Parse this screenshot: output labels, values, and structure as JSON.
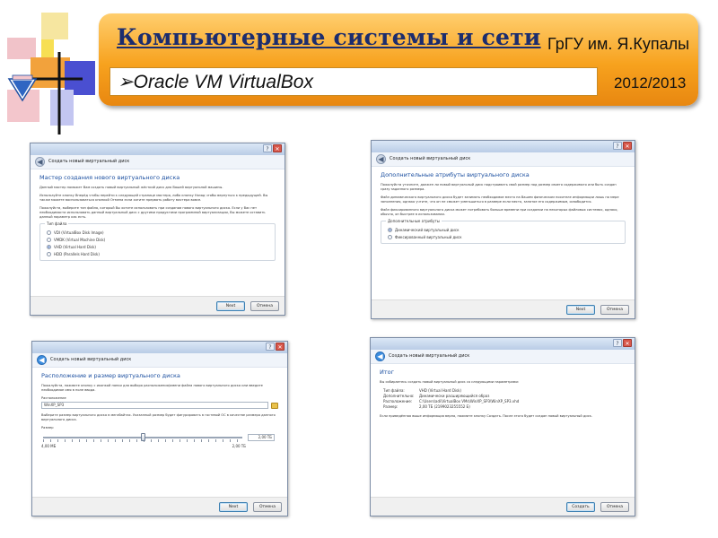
{
  "banner": {
    "title": "Компьютерные системы и сети",
    "university": "ГрГУ им. Я.Купалы",
    "subtitle": "Oracle VM VirtualBox",
    "year": "2012/2013"
  },
  "colors": {
    "banner_gradient": [
      "#ffce6e",
      "#f7a21e",
      "#e88710"
    ],
    "title_color": "#1c2d6e",
    "heading_color": "#1b4fa0"
  },
  "dialogs": {
    "wizard": {
      "caption": "Создать новый виртуальный диск",
      "heading": "Мастер создания нового виртуального диска",
      "p1": "Данный мастер поможет Вам создать новый виртуальный жёсткий диск для Вашей виртуальной машины.",
      "p2": "Используйте кнопку Вперёд чтобы перейти к следующей странице мастера, либо кнопку Назад чтобы вернуться к предыдущей. Вы также можете воспользоваться кнопкой Отмена если хотите прервать работу мастера вовсе.",
      "p3": "Пожалуйста, выберите тип файла, который Вы хотите использовать при создании нового виртуального диска. Если у Вас нет необходимости использовать данный виртуальный диск с другими продуктами программной виртуализации, Вы можете оставить данный параметр как есть.",
      "group_label": "Тип файла",
      "options": [
        {
          "label": "VDI (VirtualBox Disk Image)",
          "selected": false
        },
        {
          "label": "VMDK (Virtual Machine Disk)",
          "selected": false
        },
        {
          "label": "VHD (Virtual Hard Disk)",
          "selected": true
        },
        {
          "label": "HDD (Parallels Hard Disk)",
          "selected": false
        }
      ],
      "next_label": "Next",
      "cancel_label": "Отмена"
    },
    "attributes": {
      "caption": "Создать новый виртуальный диск",
      "heading": "Дополнительные атрибуты виртуального диска",
      "p1": "Пожалуйста уточните, должен ли новый виртуальный диск подстраивать свой размер под размер своего содержимого или быть создан сразу заданного размера.",
      "p2": "Файл динамического виртуального диска будет занимать необходимое место на Вашем физическом носителе информации лишь по мере заполнения, однако учтите, что он не сможет уменьшиться в размере если место, занятое его содержимым, освободится.",
      "p3": "Файл фиксированного виртуального диска может потребовать больше времени при создании на некоторых файловых системах, однако, обычно, он быстрее в использовании.",
      "group_label": "Дополнительные атрибуты",
      "options": [
        {
          "label": "Динамический виртуальный диск",
          "selected": true
        },
        {
          "label": "Фиксированный виртуальный диск",
          "selected": false
        }
      ],
      "next_label": "Next",
      "cancel_label": "Отмена"
    },
    "location": {
      "caption": "Создать новый виртуальный диск",
      "heading": "Расположение и размер виртуального диска",
      "p1": "Пожалуйста, нажмите кнопку с иконкой папки для выбора расположения/имени файла нового виртуального диска или введите необходимое имя в поле ввода.",
      "location_label": "Расположение",
      "location_value": "WinXP_SP3",
      "p2": "Выберите размер виртуального диска в мегабайтах. Указанный размер будет фигурировать в гостевой ОС в качестве размера данного виртуального диска.",
      "size_label": "Размер",
      "size_value": "2,00 ТБ",
      "slider_fraction": 0.5,
      "min_label": "4,00 МБ",
      "max_label": "2,00 ТБ",
      "next_label": "Next",
      "cancel_label": "Отмена"
    },
    "summary": {
      "caption": "Создать новый виртуальный диск",
      "heading": "Итог",
      "p1": "Вы собираетесь создать новый виртуальный диск со следующими параметрами:",
      "rows": [
        {
          "k": "Тип файла:",
          "v": "VHD (Virtual Hard Disk)"
        },
        {
          "k": "Дополнительно:",
          "v": "Динамически расширяющийся образ"
        },
        {
          "k": "Расположение:",
          "v": "C:\\Users\\adi\\VirtualBox VMs\\WinXP_SP3\\WinXP_SP3.vhd"
        },
        {
          "k": "Размер:",
          "v": "2,00 ТБ (2199023255552 Б)"
        }
      ],
      "p2": "Если приведённая выше информация верна, нажмите кнопку Создать. После этого будет создан новый виртуальный диск.",
      "create_label": "Создать",
      "cancel_label": "Отмена"
    }
  }
}
